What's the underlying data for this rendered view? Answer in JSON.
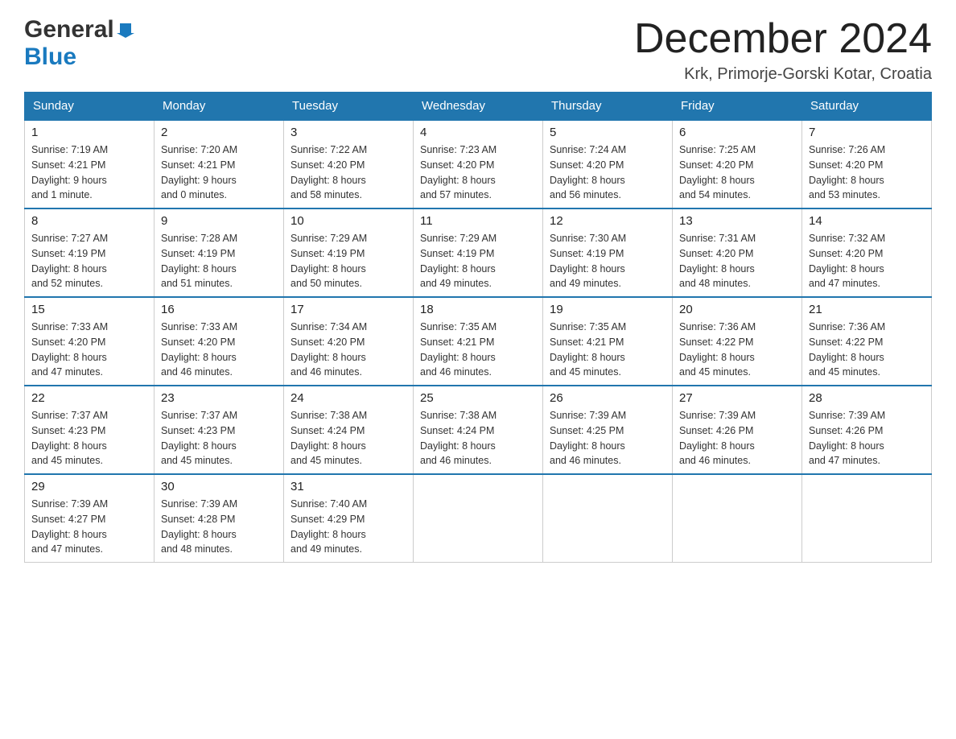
{
  "header": {
    "logo_general": "General",
    "logo_blue": "Blue",
    "month_title": "December 2024",
    "location": "Krk, Primorje-Gorski Kotar, Croatia"
  },
  "weekdays": [
    "Sunday",
    "Monday",
    "Tuesday",
    "Wednesday",
    "Thursday",
    "Friday",
    "Saturday"
  ],
  "weeks": [
    [
      {
        "day": "1",
        "sunrise": "7:19 AM",
        "sunset": "4:21 PM",
        "daylight": "9 hours and 1 minute."
      },
      {
        "day": "2",
        "sunrise": "7:20 AM",
        "sunset": "4:21 PM",
        "daylight": "9 hours and 0 minutes."
      },
      {
        "day": "3",
        "sunrise": "7:22 AM",
        "sunset": "4:20 PM",
        "daylight": "8 hours and 58 minutes."
      },
      {
        "day": "4",
        "sunrise": "7:23 AM",
        "sunset": "4:20 PM",
        "daylight": "8 hours and 57 minutes."
      },
      {
        "day": "5",
        "sunrise": "7:24 AM",
        "sunset": "4:20 PM",
        "daylight": "8 hours and 56 minutes."
      },
      {
        "day": "6",
        "sunrise": "7:25 AM",
        "sunset": "4:20 PM",
        "daylight": "8 hours and 54 minutes."
      },
      {
        "day": "7",
        "sunrise": "7:26 AM",
        "sunset": "4:20 PM",
        "daylight": "8 hours and 53 minutes."
      }
    ],
    [
      {
        "day": "8",
        "sunrise": "7:27 AM",
        "sunset": "4:19 PM",
        "daylight": "8 hours and 52 minutes."
      },
      {
        "day": "9",
        "sunrise": "7:28 AM",
        "sunset": "4:19 PM",
        "daylight": "8 hours and 51 minutes."
      },
      {
        "day": "10",
        "sunrise": "7:29 AM",
        "sunset": "4:19 PM",
        "daylight": "8 hours and 50 minutes."
      },
      {
        "day": "11",
        "sunrise": "7:29 AM",
        "sunset": "4:19 PM",
        "daylight": "8 hours and 49 minutes."
      },
      {
        "day": "12",
        "sunrise": "7:30 AM",
        "sunset": "4:19 PM",
        "daylight": "8 hours and 49 minutes."
      },
      {
        "day": "13",
        "sunrise": "7:31 AM",
        "sunset": "4:20 PM",
        "daylight": "8 hours and 48 minutes."
      },
      {
        "day": "14",
        "sunrise": "7:32 AM",
        "sunset": "4:20 PM",
        "daylight": "8 hours and 47 minutes."
      }
    ],
    [
      {
        "day": "15",
        "sunrise": "7:33 AM",
        "sunset": "4:20 PM",
        "daylight": "8 hours and 47 minutes."
      },
      {
        "day": "16",
        "sunrise": "7:33 AM",
        "sunset": "4:20 PM",
        "daylight": "8 hours and 46 minutes."
      },
      {
        "day": "17",
        "sunrise": "7:34 AM",
        "sunset": "4:20 PM",
        "daylight": "8 hours and 46 minutes."
      },
      {
        "day": "18",
        "sunrise": "7:35 AM",
        "sunset": "4:21 PM",
        "daylight": "8 hours and 46 minutes."
      },
      {
        "day": "19",
        "sunrise": "7:35 AM",
        "sunset": "4:21 PM",
        "daylight": "8 hours and 45 minutes."
      },
      {
        "day": "20",
        "sunrise": "7:36 AM",
        "sunset": "4:22 PM",
        "daylight": "8 hours and 45 minutes."
      },
      {
        "day": "21",
        "sunrise": "7:36 AM",
        "sunset": "4:22 PM",
        "daylight": "8 hours and 45 minutes."
      }
    ],
    [
      {
        "day": "22",
        "sunrise": "7:37 AM",
        "sunset": "4:23 PM",
        "daylight": "8 hours and 45 minutes."
      },
      {
        "day": "23",
        "sunrise": "7:37 AM",
        "sunset": "4:23 PM",
        "daylight": "8 hours and 45 minutes."
      },
      {
        "day": "24",
        "sunrise": "7:38 AM",
        "sunset": "4:24 PM",
        "daylight": "8 hours and 45 minutes."
      },
      {
        "day": "25",
        "sunrise": "7:38 AM",
        "sunset": "4:24 PM",
        "daylight": "8 hours and 46 minutes."
      },
      {
        "day": "26",
        "sunrise": "7:39 AM",
        "sunset": "4:25 PM",
        "daylight": "8 hours and 46 minutes."
      },
      {
        "day": "27",
        "sunrise": "7:39 AM",
        "sunset": "4:26 PM",
        "daylight": "8 hours and 46 minutes."
      },
      {
        "day": "28",
        "sunrise": "7:39 AM",
        "sunset": "4:26 PM",
        "daylight": "8 hours and 47 minutes."
      }
    ],
    [
      {
        "day": "29",
        "sunrise": "7:39 AM",
        "sunset": "4:27 PM",
        "daylight": "8 hours and 47 minutes."
      },
      {
        "day": "30",
        "sunrise": "7:39 AM",
        "sunset": "4:28 PM",
        "daylight": "8 hours and 48 minutes."
      },
      {
        "day": "31",
        "sunrise": "7:40 AM",
        "sunset": "4:29 PM",
        "daylight": "8 hours and 49 minutes."
      },
      null,
      null,
      null,
      null
    ]
  ],
  "labels": {
    "sunrise": "Sunrise:",
    "sunset": "Sunset:",
    "daylight": "Daylight:"
  }
}
